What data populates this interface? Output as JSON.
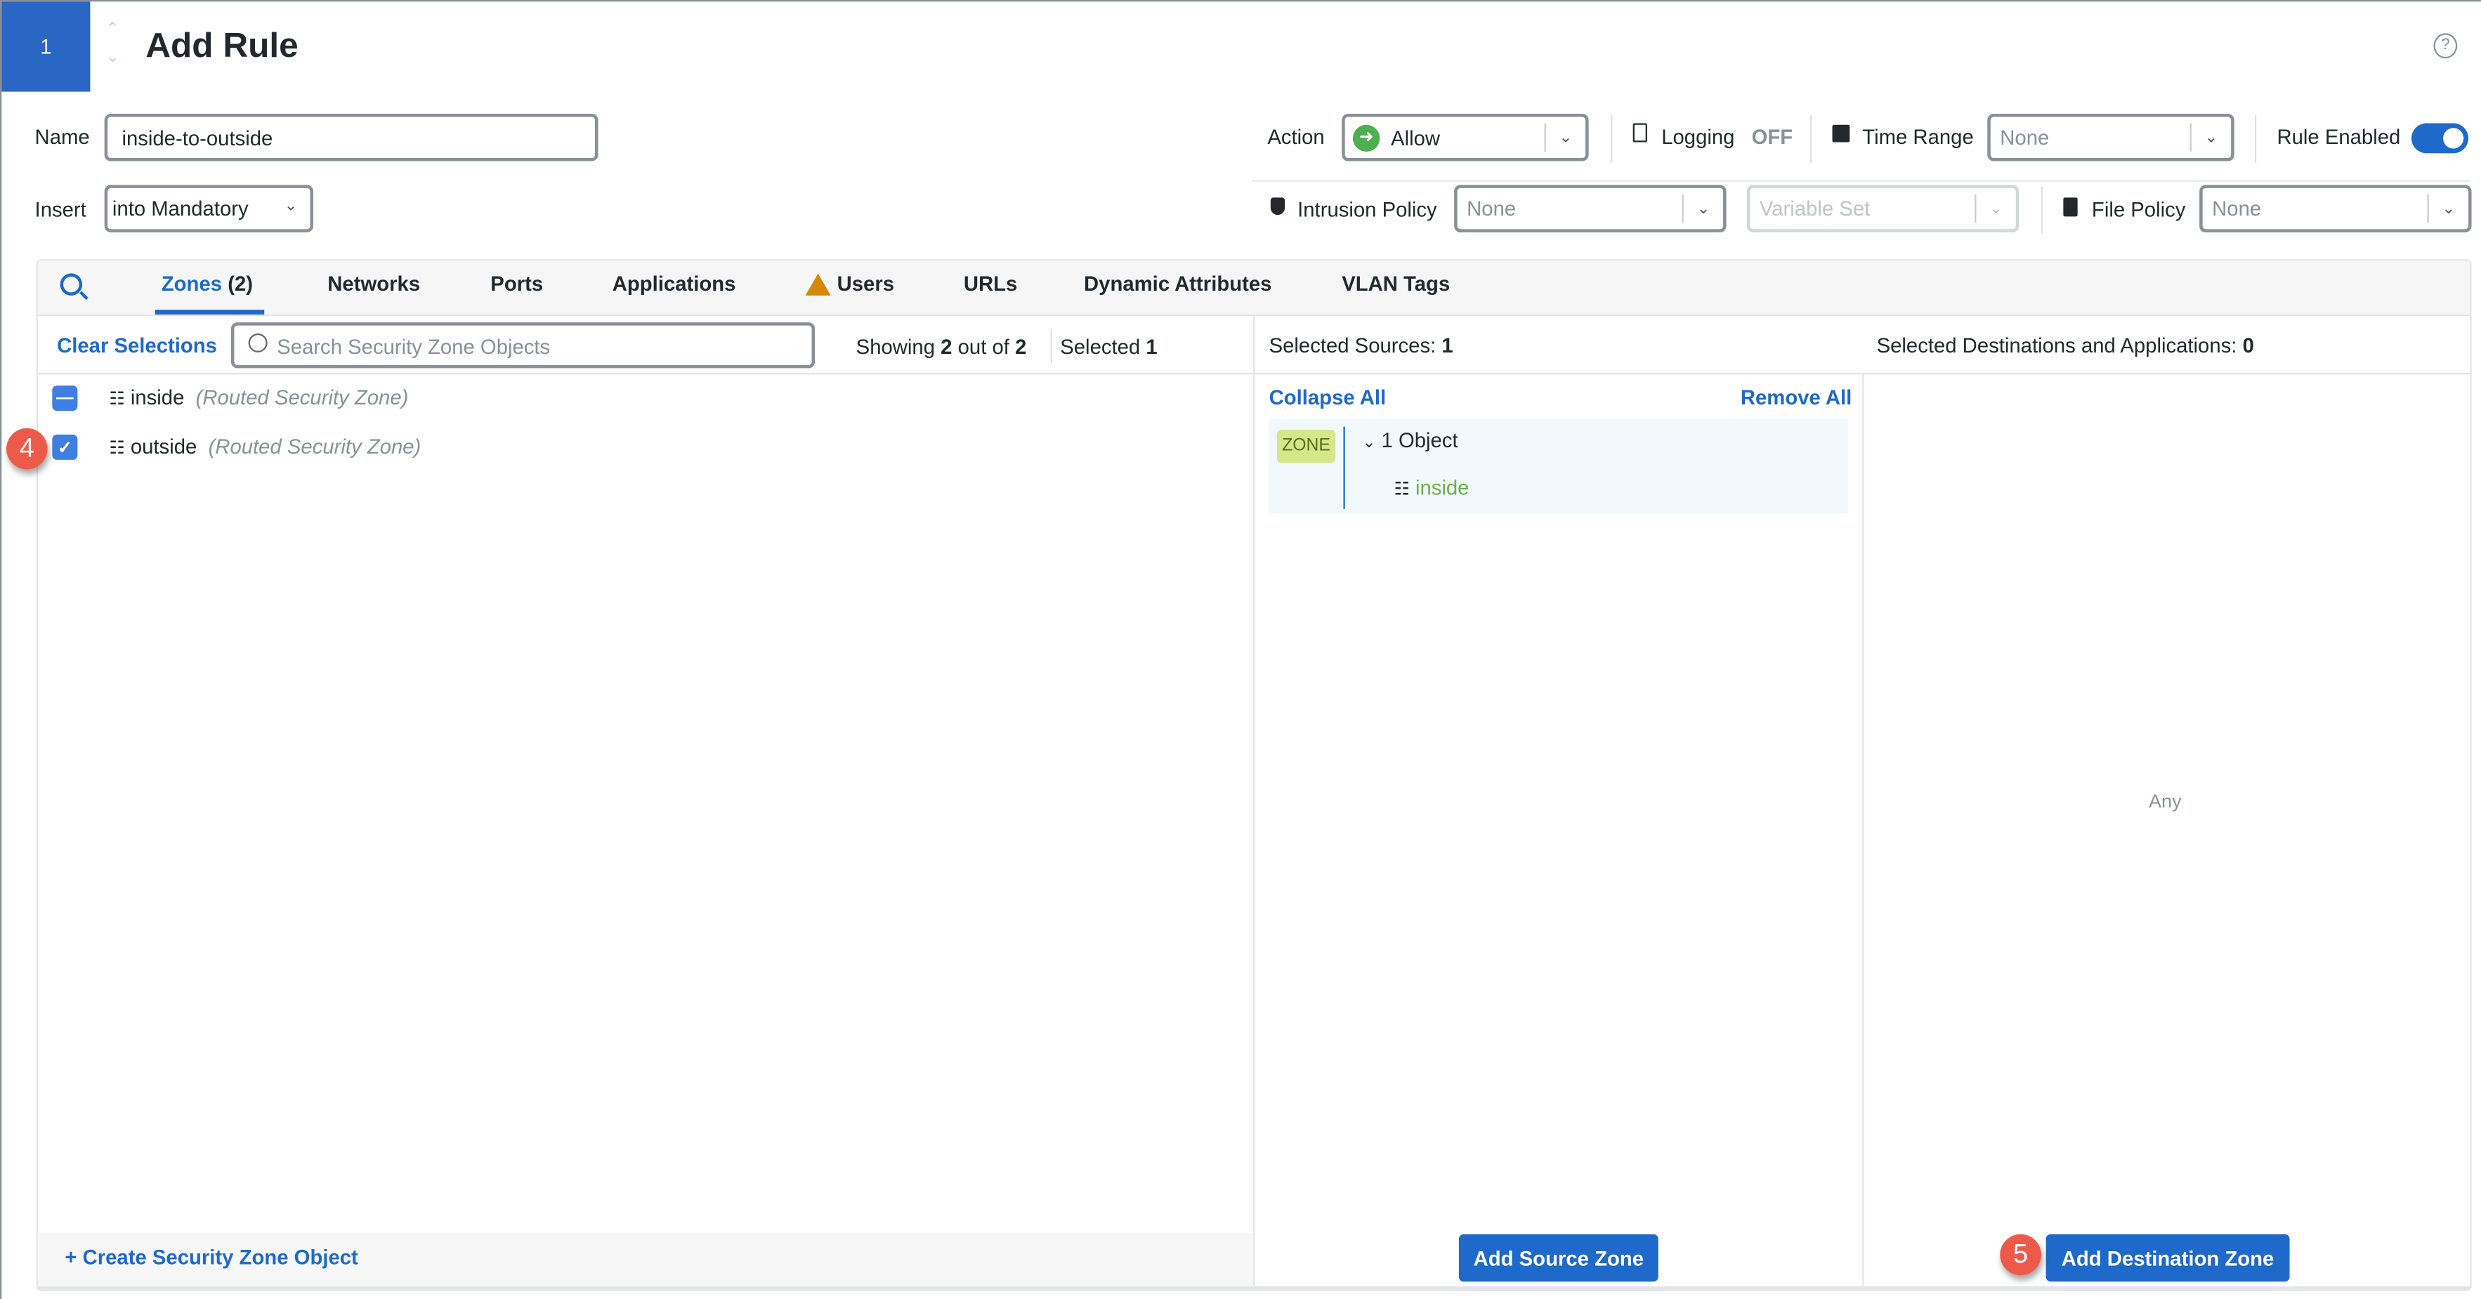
{
  "header": {
    "rule_number": "1",
    "title": "Add Rule",
    "help_icon": "question-circle-icon"
  },
  "form": {
    "name_label": "Name",
    "name_value": "inside-to-outside",
    "insert_label": "Insert",
    "insert_value": "into Mandatory",
    "action_label": "Action",
    "action_value": "Allow",
    "logging_label": "Logging",
    "logging_value": "OFF",
    "time_range_label": "Time Range",
    "time_range_value": "None",
    "rule_enabled_label": "Rule Enabled",
    "rule_enabled": true,
    "intrusion_policy_label": "Intrusion Policy",
    "intrusion_policy_value": "None",
    "variable_set_placeholder": "Variable Set",
    "file_policy_label": "File Policy",
    "file_policy_value": "None"
  },
  "tabs": [
    {
      "label": "Zones",
      "count": "(2)",
      "active": true
    },
    {
      "label": "Networks"
    },
    {
      "label": "Ports"
    },
    {
      "label": "Applications"
    },
    {
      "label": "Users",
      "warning": true
    },
    {
      "label": "URLs"
    },
    {
      "label": "Dynamic Attributes"
    },
    {
      "label": "VLAN Tags"
    }
  ],
  "left": {
    "clear_selections": "Clear Selections",
    "search_placeholder": "Search Security Zone Objects",
    "showing_prefix": "Showing",
    "showing_count": "2",
    "showing_mid": "out of",
    "showing_total": "2",
    "selected_label": "Selected",
    "selected_count": "1",
    "items": [
      {
        "name": "inside",
        "type": "(Routed Security Zone)",
        "state": "indeterminate"
      },
      {
        "name": "outside",
        "type": "(Routed Security Zone)",
        "state": "checked"
      }
    ],
    "create_link": "+ Create Security Zone Object"
  },
  "sources": {
    "header_label": "Selected Sources:",
    "header_count": "1",
    "collapse_all": "Collapse All",
    "remove_all": "Remove All",
    "group_badge": "ZONE",
    "group_title": "1 Object",
    "group_items": [
      "inside"
    ],
    "add_button": "Add Source Zone"
  },
  "destinations": {
    "header_label": "Selected Destinations and Applications:",
    "header_count": "0",
    "empty_text": "Any",
    "add_button": "Add Destination Zone"
  },
  "annotations": {
    "step4": "4",
    "step5": "5"
  },
  "colors": {
    "primary": "#1e69c9",
    "allow_green": "#4caf50",
    "zone_badge": "#d6e68a",
    "zone_item_green": "#6cb04a",
    "warning": "#d4890a",
    "annotation_red": "#ee5a4a"
  }
}
